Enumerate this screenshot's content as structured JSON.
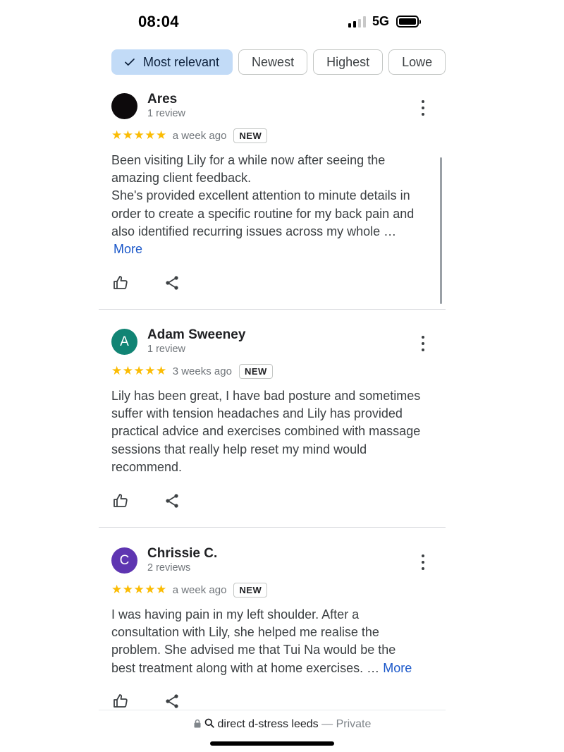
{
  "status_bar": {
    "time": "08:04",
    "network": "5G",
    "signal_bars_filled": 2,
    "signal_bars_total": 4,
    "battery_level": 1.0
  },
  "filters": {
    "chips": [
      {
        "label": "Most relevant",
        "selected": true
      },
      {
        "label": "Newest",
        "selected": false
      },
      {
        "label": "Highest",
        "selected": false
      },
      {
        "label": "Lowe",
        "selected": false
      }
    ]
  },
  "reviews": [
    {
      "author": "Ares",
      "review_count": "1 review",
      "avatar_letter": "",
      "avatar_color": "#0d0a0c",
      "stars": "★★★★★",
      "rating": 5,
      "date": "a week ago",
      "badge": "NEW",
      "text_lines": [
        "Been visiting Lily for a while now after seeing the",
        "amazing client feedback.",
        "She's provided excellent attention to minute details in",
        "order to create a specific routine for my back pain and",
        "also identified recurring issues across my whole …"
      ],
      "more_label": "More"
    },
    {
      "author": "Adam Sweeney",
      "review_count": "1 review",
      "avatar_letter": "A",
      "avatar_color": "#118474",
      "stars": "★★★★★",
      "rating": 5,
      "date": "3 weeks ago",
      "badge": "NEW",
      "text_lines": [
        "Lily has been great, I have bad posture and sometimes",
        "suffer with tension headaches and Lily has provided",
        "practical advice and exercises combined with massage",
        "sessions that really help reset my mind would",
        "recommend."
      ]
    },
    {
      "author": "Chrissie C.",
      "review_count": "2 reviews",
      "avatar_letter": "C",
      "avatar_color": "#5e35b1",
      "stars": "★★★★★",
      "rating": 5,
      "date": "a week ago",
      "badge": "NEW",
      "text_lines": [
        "I was having pain in my left shoulder. After a",
        "consultation with Lily, she helped me realise the",
        "problem. She advised me that Tui Na would be the",
        "best treatment along with at home exercises. …"
      ],
      "more_label": "More"
    }
  ],
  "browser": {
    "query": "direct d-stress leeds",
    "separator": " — ",
    "mode": "Private"
  },
  "colors": {
    "chip_selected_bg": "#c2dbf7",
    "star": "#fbbc04",
    "link": "#1a57c9"
  },
  "icons": [
    "check-icon",
    "more-vert-icon",
    "thumb-up-icon",
    "share-icon",
    "lock-icon",
    "search-icon"
  ]
}
